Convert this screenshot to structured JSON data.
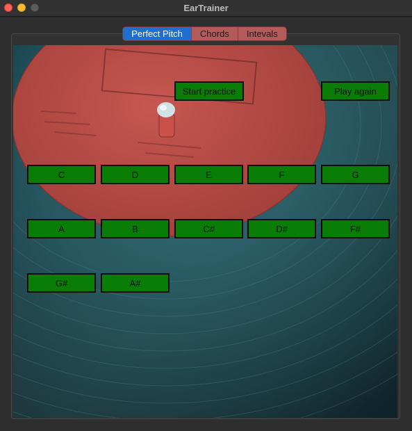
{
  "window": {
    "title": "EarTrainer"
  },
  "tabs": [
    {
      "label": "Perfect Pitch",
      "active": true
    },
    {
      "label": "Chords",
      "active": false
    },
    {
      "label": "Intevals",
      "active": false
    }
  ],
  "controls": {
    "start_label": "Start practice",
    "play_again_label": "Play again"
  },
  "notes": {
    "c": "C",
    "d": "D",
    "e": "E",
    "f": "F",
    "g": "G",
    "a": "A",
    "b": "B",
    "c_sharp": "C#",
    "d_sharp": "D#",
    "f_sharp": "F#",
    "g_sharp": "G#",
    "a_sharp": "A#"
  },
  "colors": {
    "button_green": "#0a7d06",
    "tab_active": "#1f6fd1",
    "tab_inactive": "#b35a5a",
    "vinyl_teal": "#1f5a63",
    "label_red": "#b5443f"
  }
}
